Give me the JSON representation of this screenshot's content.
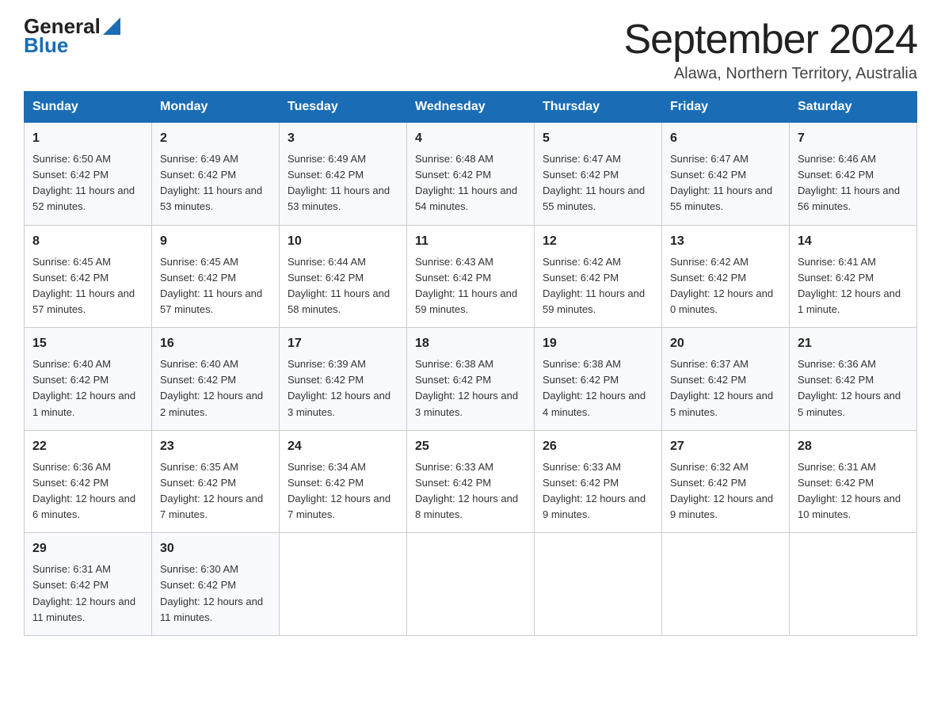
{
  "header": {
    "title": "September 2024",
    "subtitle": "Alawa, Northern Territory, Australia",
    "logo": {
      "general": "General",
      "blue": "Blue"
    }
  },
  "weekdays": [
    "Sunday",
    "Monday",
    "Tuesday",
    "Wednesday",
    "Thursday",
    "Friday",
    "Saturday"
  ],
  "weeks": [
    [
      {
        "day": "1",
        "sunrise": "6:50 AM",
        "sunset": "6:42 PM",
        "daylight": "11 hours and 52 minutes."
      },
      {
        "day": "2",
        "sunrise": "6:49 AM",
        "sunset": "6:42 PM",
        "daylight": "11 hours and 53 minutes."
      },
      {
        "day": "3",
        "sunrise": "6:49 AM",
        "sunset": "6:42 PM",
        "daylight": "11 hours and 53 minutes."
      },
      {
        "day": "4",
        "sunrise": "6:48 AM",
        "sunset": "6:42 PM",
        "daylight": "11 hours and 54 minutes."
      },
      {
        "day": "5",
        "sunrise": "6:47 AM",
        "sunset": "6:42 PM",
        "daylight": "11 hours and 55 minutes."
      },
      {
        "day": "6",
        "sunrise": "6:47 AM",
        "sunset": "6:42 PM",
        "daylight": "11 hours and 55 minutes."
      },
      {
        "day": "7",
        "sunrise": "6:46 AM",
        "sunset": "6:42 PM",
        "daylight": "11 hours and 56 minutes."
      }
    ],
    [
      {
        "day": "8",
        "sunrise": "6:45 AM",
        "sunset": "6:42 PM",
        "daylight": "11 hours and 57 minutes."
      },
      {
        "day": "9",
        "sunrise": "6:45 AM",
        "sunset": "6:42 PM",
        "daylight": "11 hours and 57 minutes."
      },
      {
        "day": "10",
        "sunrise": "6:44 AM",
        "sunset": "6:42 PM",
        "daylight": "11 hours and 58 minutes."
      },
      {
        "day": "11",
        "sunrise": "6:43 AM",
        "sunset": "6:42 PM",
        "daylight": "11 hours and 59 minutes."
      },
      {
        "day": "12",
        "sunrise": "6:42 AM",
        "sunset": "6:42 PM",
        "daylight": "11 hours and 59 minutes."
      },
      {
        "day": "13",
        "sunrise": "6:42 AM",
        "sunset": "6:42 PM",
        "daylight": "12 hours and 0 minutes."
      },
      {
        "day": "14",
        "sunrise": "6:41 AM",
        "sunset": "6:42 PM",
        "daylight": "12 hours and 1 minute."
      }
    ],
    [
      {
        "day": "15",
        "sunrise": "6:40 AM",
        "sunset": "6:42 PM",
        "daylight": "12 hours and 1 minute."
      },
      {
        "day": "16",
        "sunrise": "6:40 AM",
        "sunset": "6:42 PM",
        "daylight": "12 hours and 2 minutes."
      },
      {
        "day": "17",
        "sunrise": "6:39 AM",
        "sunset": "6:42 PM",
        "daylight": "12 hours and 3 minutes."
      },
      {
        "day": "18",
        "sunrise": "6:38 AM",
        "sunset": "6:42 PM",
        "daylight": "12 hours and 3 minutes."
      },
      {
        "day": "19",
        "sunrise": "6:38 AM",
        "sunset": "6:42 PM",
        "daylight": "12 hours and 4 minutes."
      },
      {
        "day": "20",
        "sunrise": "6:37 AM",
        "sunset": "6:42 PM",
        "daylight": "12 hours and 5 minutes."
      },
      {
        "day": "21",
        "sunrise": "6:36 AM",
        "sunset": "6:42 PM",
        "daylight": "12 hours and 5 minutes."
      }
    ],
    [
      {
        "day": "22",
        "sunrise": "6:36 AM",
        "sunset": "6:42 PM",
        "daylight": "12 hours and 6 minutes."
      },
      {
        "day": "23",
        "sunrise": "6:35 AM",
        "sunset": "6:42 PM",
        "daylight": "12 hours and 7 minutes."
      },
      {
        "day": "24",
        "sunrise": "6:34 AM",
        "sunset": "6:42 PM",
        "daylight": "12 hours and 7 minutes."
      },
      {
        "day": "25",
        "sunrise": "6:33 AM",
        "sunset": "6:42 PM",
        "daylight": "12 hours and 8 minutes."
      },
      {
        "day": "26",
        "sunrise": "6:33 AM",
        "sunset": "6:42 PM",
        "daylight": "12 hours and 9 minutes."
      },
      {
        "day": "27",
        "sunrise": "6:32 AM",
        "sunset": "6:42 PM",
        "daylight": "12 hours and 9 minutes."
      },
      {
        "day": "28",
        "sunrise": "6:31 AM",
        "sunset": "6:42 PM",
        "daylight": "12 hours and 10 minutes."
      }
    ],
    [
      {
        "day": "29",
        "sunrise": "6:31 AM",
        "sunset": "6:42 PM",
        "daylight": "12 hours and 11 minutes."
      },
      {
        "day": "30",
        "sunrise": "6:30 AM",
        "sunset": "6:42 PM",
        "daylight": "12 hours and 11 minutes."
      },
      null,
      null,
      null,
      null,
      null
    ]
  ]
}
